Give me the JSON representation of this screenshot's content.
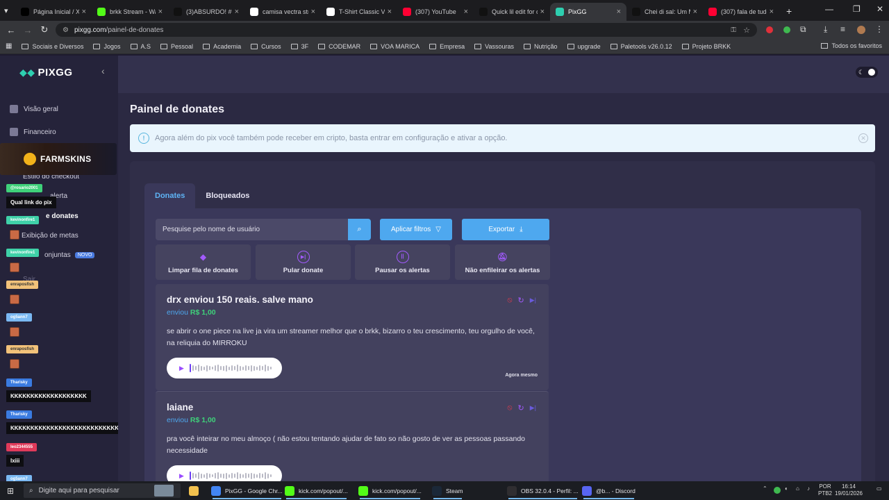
{
  "browser": {
    "tabs": [
      {
        "title": "Página Inicial / X",
        "icon": "x-icon",
        "color": "#000000"
      },
      {
        "title": "brkk Stream - Wa",
        "icon": "kick-icon",
        "color": "#53fc18"
      },
      {
        "title": "(3)ABSURDO! #bl",
        "icon": "tiktok-icon",
        "color": "#111111"
      },
      {
        "title": "camisa vectra stra",
        "icon": "google-icon",
        "color": "#ffffff"
      },
      {
        "title": "T-Shirt Classic Ve",
        "icon": "steam-icon",
        "color": "#ffffff"
      },
      {
        "title": "(307) YouTube",
        "icon": "youtube-icon",
        "color": "#ff0033"
      },
      {
        "title": "Quick lil edit for c",
        "icon": "tiktok-icon",
        "color": "#111111"
      },
      {
        "title": "PixGG",
        "icon": "pixgg-icon",
        "color": "#2ecfb0",
        "active": true
      },
      {
        "title": "Chei di sal: Um M",
        "icon": "tiktok-icon",
        "color": "#111111"
      },
      {
        "title": "(307) fala de tudo",
        "icon": "youtube-icon",
        "color": "#ff0033"
      }
    ],
    "url_domain": "pixgg.com",
    "url_path": "/painel-de-donates",
    "bookmarks": [
      "Sociais e Diversos",
      "Jogos",
      "A.S",
      "Pessoal",
      "Academia",
      "Cursos",
      "3F",
      "CODEMAR",
      "VOA MARICA",
      "Empresa",
      "Vassouras",
      "Nutrição",
      "upgrade",
      "Paletools v26.0.12",
      "Projeto BRKK"
    ],
    "bookmarks_right": "Todos os favoritos"
  },
  "sidebar": {
    "brand": "PIXGG",
    "items": [
      {
        "label": "Visão geral"
      },
      {
        "label": "Financeiro"
      },
      {
        "label": "Estilo do checkout"
      },
      {
        "label": "alerta"
      },
      {
        "label": "e donates"
      },
      {
        "label": "Exibição de metas"
      },
      {
        "label": "onjuntas"
      }
    ],
    "new_badge": "NOVO",
    "hidden_item": "Sair"
  },
  "overlay": {
    "farmskins": "FARMSKINS",
    "chat": [
      {
        "user": "@rosario2001",
        "color": "#3fd17a"
      },
      {
        "msg": "Qual link do pix"
      },
      {
        "user": "kevinonfire1",
        "color": "#3fd1a8"
      },
      {
        "user": "kevinonfire1",
        "color": "#3fd1a8"
      },
      {
        "user": "enraposfish",
        "color": "#f2c27a"
      },
      {
        "user": "og5ann7",
        "color": "#7ab8f2"
      },
      {
        "user": "enraposfish",
        "color": "#f2c27a"
      },
      {
        "user": "Tharisky",
        "color": "#3a7be0"
      },
      {
        "msg": "KKKKKKKKKKKKKKKKKKK"
      },
      {
        "user": "Tharisky",
        "color": "#3a7be0"
      },
      {
        "msg": "KKKKKKKKKKKKKKKKKKKKKKKKKKKKKKKKKK"
      },
      {
        "user": "leo2344555",
        "color": "#e03a5a"
      },
      {
        "msg": "lxiii"
      },
      {
        "user": "og5ann7",
        "color": "#7ab8f2"
      }
    ]
  },
  "page": {
    "title": "Painel de donates",
    "banner": "Agora além do pix você também pode receber em cripto, basta entrar em configuração e ativar a opção.",
    "tabs": [
      "Donates",
      "Bloqueados"
    ],
    "search_placeholder": "Pesquise pelo nome de usuário",
    "filters_label": "Aplicar filtros",
    "export_label": "Exportar",
    "actions": [
      {
        "label": "Limpar fila de donates",
        "icon": "eraser-icon"
      },
      {
        "label": "Pular donate",
        "icon": "skip-icon"
      },
      {
        "label": "Pausar os alertas",
        "icon": "pause-icon"
      },
      {
        "label": "Não enfileirar os alertas",
        "icon": "bell-off-icon"
      }
    ],
    "donates": [
      {
        "title": "drx enviou 150 reais. salve mano",
        "sent_label": "enviou",
        "amount": "R$ 1,00",
        "message": "se abrir o one piece na live ja vira um streamer melhor que o brkk, bizarro o teu crescimento, teu orgulho de você, na reliquia do MIRROKU",
        "time": "Agora mesmo"
      },
      {
        "title": "laiane",
        "sent_label": "enviou",
        "amount": "R$ 1,00",
        "message": "pra você inteirar no meu almoço ( não estou tentando ajudar de fato so não gosto de ver as pessoas passando necessidade",
        "time": ""
      }
    ]
  },
  "taskbar": {
    "search": "Digite aqui para pesquisar",
    "apps": [
      {
        "label": "PixGG - Google Chr...",
        "color": "#4285f4"
      },
      {
        "label": "kick.com/popout/...",
        "color": "#53fc18"
      },
      {
        "label": "kick.com/popout/...",
        "color": "#53fc18"
      },
      {
        "label": "Steam",
        "color": "#1b2838"
      },
      {
        "label": "OBS 32.0.4 - Perfil: ...",
        "color": "#302e31"
      },
      {
        "label": "@b... - Discord",
        "color": "#5865f2"
      }
    ],
    "lang": "POR",
    "lang2": "PTB2",
    "time": "16:14",
    "date": "19/01/2026"
  }
}
